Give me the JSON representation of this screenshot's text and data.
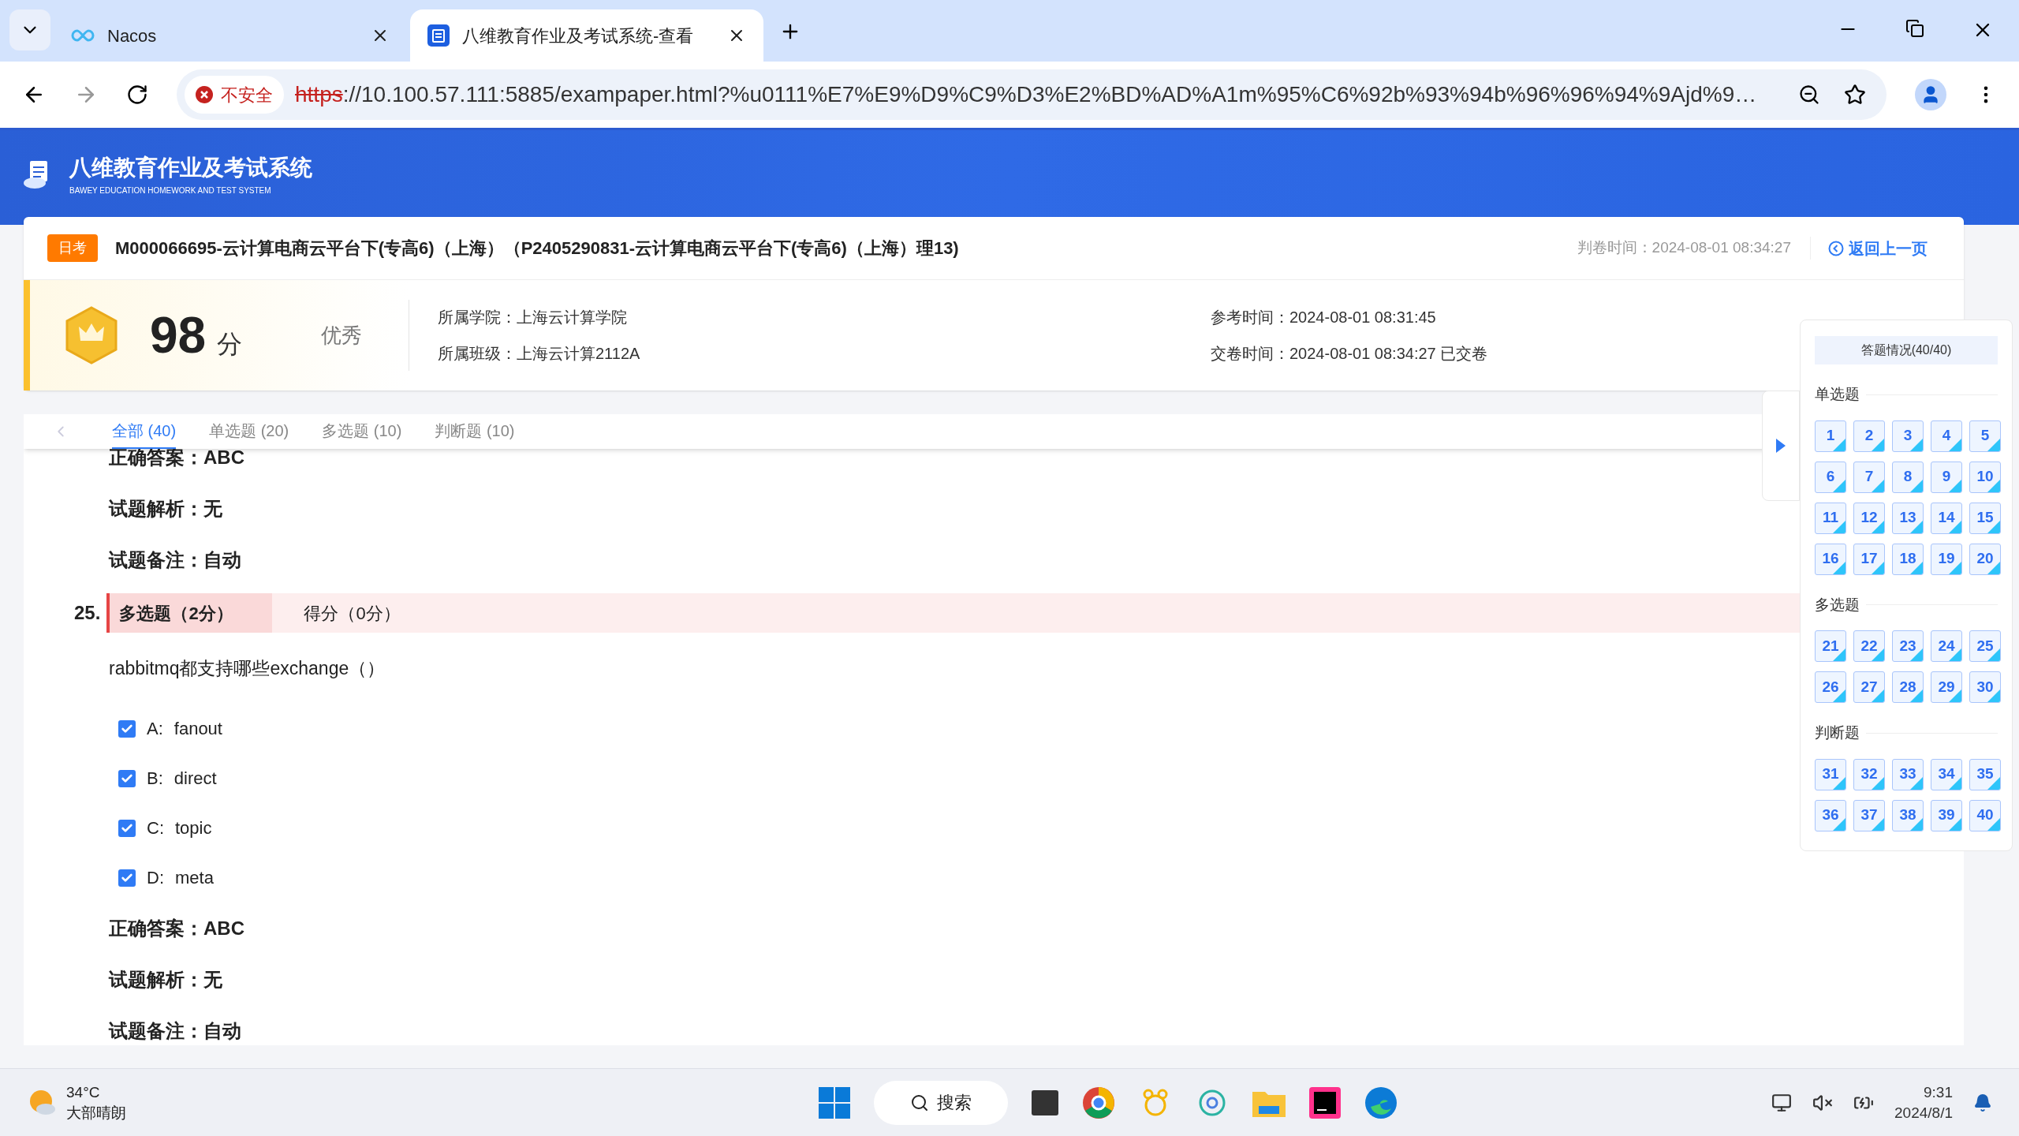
{
  "browser": {
    "tabs": [
      {
        "title": "Nacos",
        "selected": false,
        "kind": "nacos"
      },
      {
        "title": "八维教育作业及考试系统-查看",
        "selected": true,
        "kind": "doc"
      }
    ],
    "security": "不安全",
    "url_scheme": "https",
    "url_rest": "://10.100.57.111:5885/exampaper.html?%u0111%E7%E9%D9%C9%D3%E2%BD%AD%A1m%95%C6%92b%93%94b%96%96%94%9Ajd%9…"
  },
  "header": {
    "system_name": "八维教育作业及考试系统",
    "system_subtitle": "BAWEY EDUCATION HOMEWORK AND TEST SYSTEM"
  },
  "exam": {
    "badge": "日考",
    "title": "M000066695-云计算电商云平台下(专高6)（上海）（P2405290831-云计算电商云平台下(专高6)（上海）理13)",
    "graded_time": "判卷时间：2024-08-01 08:34:27",
    "back_link": "返回上一页",
    "score": "98",
    "score_unit": "分",
    "grade": "优秀",
    "info_left": [
      "所属学院：上海云计算学院",
      "所属班级：上海云计算2112A"
    ],
    "info_right": [
      "参考时间：2024-08-01 08:31:45",
      "交卷时间：2024-08-01 08:34:27 已交卷"
    ]
  },
  "filter_tabs": [
    {
      "label": "全部 (40)",
      "selected": true
    },
    {
      "label": "单选题 (20)",
      "selected": false
    },
    {
      "label": "多选题 (10)",
      "selected": false
    },
    {
      "label": "判断题 (10)",
      "selected": false
    }
  ],
  "previous_tail": [
    "正确答案：ABC",
    "试题解析：无",
    "试题备注：自动"
  ],
  "question": {
    "number": "25.",
    "type": "多选题（2分）",
    "score": "得分（0分）",
    "text": "rabbitmq都支持哪些exchange（）",
    "options": [
      {
        "label": "A:",
        "text": "fanout",
        "checked": true
      },
      {
        "label": "B:",
        "text": "direct",
        "checked": true
      },
      {
        "label": "C:",
        "text": "topic",
        "checked": true
      },
      {
        "label": "D:",
        "text": "meta",
        "checked": true
      }
    ],
    "footer": [
      "正确答案：ABC",
      "试题解析：无",
      "试题备注：自动"
    ]
  },
  "answer_panel": {
    "title": "答题情况(40/40)",
    "sections": [
      {
        "name": "单选题",
        "items": [
          {
            "label": "1",
            "answered": true
          },
          {
            "label": "2",
            "answered": true
          },
          {
            "label": "3",
            "answered": true
          },
          {
            "label": "4",
            "answered": true
          },
          {
            "label": "5",
            "answered": true
          },
          {
            "label": "6",
            "answered": true
          },
          {
            "label": "7",
            "answered": true
          },
          {
            "label": "8",
            "answered": true
          },
          {
            "label": "9",
            "answered": true
          },
          {
            "label": "10",
            "answered": true
          },
          {
            "label": "11",
            "answered": true
          },
          {
            "label": "12",
            "answered": true
          },
          {
            "label": "13",
            "answered": true
          },
          {
            "label": "14",
            "answered": true
          },
          {
            "label": "15",
            "answered": true
          },
          {
            "label": "16",
            "answered": true
          },
          {
            "label": "17",
            "answered": true
          },
          {
            "label": "18",
            "answered": true
          },
          {
            "label": "19",
            "answered": true
          },
          {
            "label": "20",
            "answered": true
          }
        ]
      },
      {
        "name": "多选题",
        "items": [
          {
            "label": "21",
            "answered": true
          },
          {
            "label": "22",
            "answered": true
          },
          {
            "label": "23",
            "answered": true
          },
          {
            "label": "24",
            "answered": true
          },
          {
            "label": "25",
            "answered": true
          },
          {
            "label": "26",
            "answered": true
          },
          {
            "label": "27",
            "answered": true
          },
          {
            "label": "28",
            "answered": true
          },
          {
            "label": "29",
            "answered": true
          },
          {
            "label": "30",
            "answered": true
          }
        ]
      },
      {
        "name": "判断题",
        "items": [
          {
            "label": "31",
            "answered": true
          },
          {
            "label": "32",
            "answered": true
          },
          {
            "label": "33",
            "answered": true
          },
          {
            "label": "34",
            "answered": true
          },
          {
            "label": "35",
            "answered": true
          },
          {
            "label": "36",
            "answered": true
          },
          {
            "label": "37",
            "answered": true
          },
          {
            "label": "38",
            "answered": true
          },
          {
            "label": "39",
            "answered": true
          },
          {
            "label": "40",
            "answered": true
          }
        ]
      }
    ]
  },
  "taskbar": {
    "temperature": "34°C",
    "weather": "大部晴朗",
    "search": "搜索",
    "time": "9:31",
    "date": "2024/8/1"
  }
}
